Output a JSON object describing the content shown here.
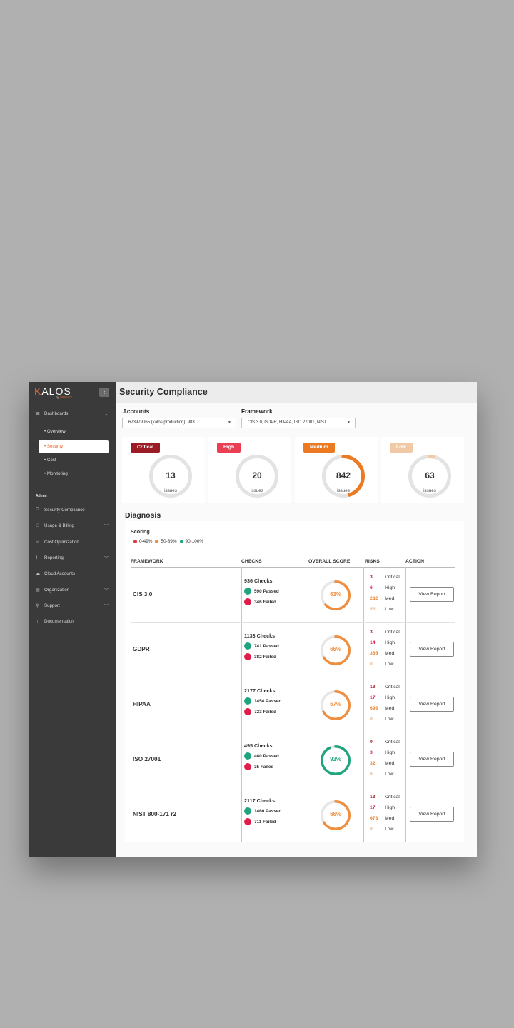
{
  "colors": {
    "critical": "#9b1c26",
    "high": "#ea3e52",
    "medium": "#ec7a22",
    "low": "#f0c9a6",
    "score_red": "#e0383e",
    "score_orange": "#ef8e3f",
    "score_green": "#1fa57d",
    "passed": "#1fa57d",
    "failed": "#e01d4a",
    "accent": "#e8652b"
  },
  "sidebar": {
    "logo": "KALOS",
    "logo_sub_prefix": "by ",
    "logo_sub_brand": "StratusX",
    "collapse_icon": "chevron-left-icon",
    "dashboards_label": "Dashboards",
    "dashboard_items": [
      {
        "label": "Overview"
      },
      {
        "label": "Security",
        "active": true
      },
      {
        "label": "Cost"
      },
      {
        "label": "Monitoring"
      }
    ],
    "admin_label": "Admin",
    "admin_items": [
      {
        "label": "Security Compliance",
        "icon": "shield-icon"
      },
      {
        "label": "Usage & Billing",
        "icon": "billing-icon"
      },
      {
        "label": "Cost Optimization",
        "icon": "cost-icon"
      },
      {
        "label": "Reporting",
        "icon": "chart-icon"
      },
      {
        "label": "Cloud Accounts",
        "icon": "cloud-icon"
      },
      {
        "label": "Organization",
        "icon": "building-icon"
      },
      {
        "label": "Support",
        "icon": "support-icon"
      },
      {
        "label": "Documentation",
        "icon": "document-icon"
      }
    ]
  },
  "header": {
    "title": "Security Compliance"
  },
  "filters": {
    "accounts_label": "Accounts",
    "accounts_value": "673979065    (kalos production), 983...",
    "framework_label": "Framework",
    "framework_value": "CIS 3.0, GDPR, HIPAA, ISO 27001, NIST ..."
  },
  "severity": [
    {
      "label": "Critical",
      "count": "13",
      "issues": "issues",
      "fraction": 0.0
    },
    {
      "label": "High",
      "count": "20",
      "issues": "issues",
      "fraction": 0.0
    },
    {
      "label": "Medium",
      "count": "842",
      "issues": "issues",
      "fraction": 0.45
    },
    {
      "label": "Low",
      "count": "63",
      "issues": "issues",
      "fraction": 0.03
    }
  ],
  "diagnosis": {
    "title": "Diagnosis",
    "scoring_label": "Scoring",
    "legend": [
      "0-49%",
      "50-89%",
      "90-100%"
    ],
    "columns": [
      "FRAMEWORK",
      "CHECKS",
      "OVERALL SCORE",
      "RISKS",
      "ACTION"
    ],
    "risk_labels": [
      "Critical",
      "High",
      "Med.",
      "Low"
    ],
    "action_label": "View Report",
    "rows": [
      {
        "framework": "CIS 3.0",
        "checks": "936 Checks",
        "passed": "590 Passed",
        "failed": "346 Failed",
        "score": "63%",
        "risks": [
          "3",
          "6",
          "282",
          "55"
        ]
      },
      {
        "framework": "GDPR",
        "checks": "1133 Checks",
        "passed": "741 Passed",
        "failed": "382 Failed",
        "score": "66%",
        "risks": [
          "3",
          "14",
          "365",
          "0"
        ]
      },
      {
        "framework": "HIPAA",
        "checks": "2177 Checks",
        "passed": "1454 Passed",
        "failed": "723 Failed",
        "score": "67%",
        "risks": [
          "13",
          "17",
          "693",
          "0"
        ]
      },
      {
        "framework": "ISO 27001",
        "checks": "495 Checks",
        "passed": "460 Passed",
        "failed": "35 Failed",
        "score": "93%",
        "risks": [
          "0",
          "3",
          "32",
          "0"
        ]
      },
      {
        "framework": "NIST 800-171 r2",
        "checks": "2117 Checks",
        "passed": "1460 Passed",
        "failed": "711 Failed",
        "score": "66%",
        "risks": [
          "13",
          "17",
          "673",
          "0"
        ]
      }
    ]
  }
}
